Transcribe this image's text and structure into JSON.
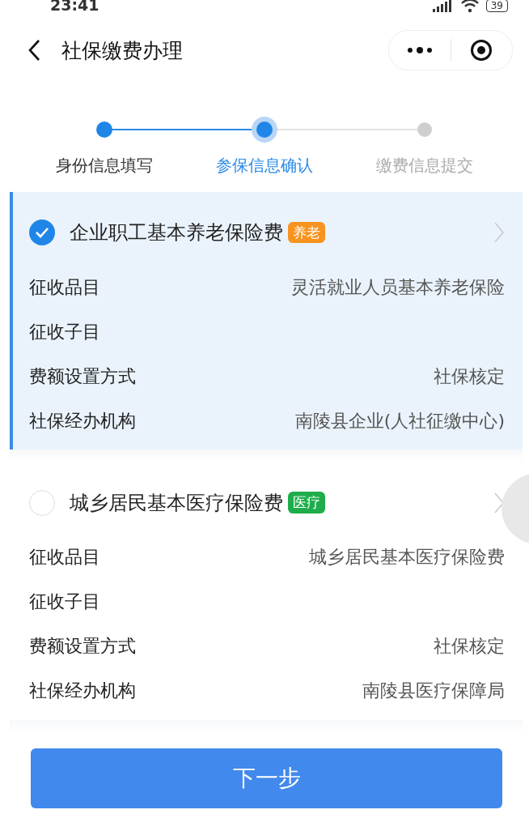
{
  "status_bar": {
    "time": "23:41",
    "battery": "39"
  },
  "header": {
    "title": "社保缴费办理"
  },
  "steps": [
    {
      "label": "身份信息填写",
      "done": true,
      "selected": false
    },
    {
      "label": "参保信息确认",
      "done": true,
      "selected": true
    },
    {
      "label": "缴费信息提交",
      "done": false,
      "selected": false
    }
  ],
  "cards": [
    {
      "title": "企业职工基本养老保险费",
      "selected": true,
      "tag": {
        "label": "养老",
        "color": "#f7931e"
      },
      "rows": [
        {
          "label": "征收品目",
          "value": "灵活就业人员基本养老保险"
        },
        {
          "label": "征收子目"
        },
        {
          "label": "费额设置方式",
          "value": "社保核定"
        },
        {
          "label": "社保经办机构",
          "value": "南陵县企业(人社征缴中心)"
        }
      ]
    },
    {
      "title": "城乡居民基本医疗保险费",
      "selected": false,
      "tag": {
        "label": "医疗",
        "color": "#1fad4b"
      },
      "rows": [
        {
          "label": "征收品目",
          "value": "城乡居民基本医疗保险费"
        },
        {
          "label": "征收子目"
        },
        {
          "label": "费额设置方式",
          "value": "社保核定"
        },
        {
          "label": "社保经办机构",
          "value": "南陵县医疗保障局"
        }
      ]
    }
  ],
  "next_button": {
    "label": "下一步"
  }
}
